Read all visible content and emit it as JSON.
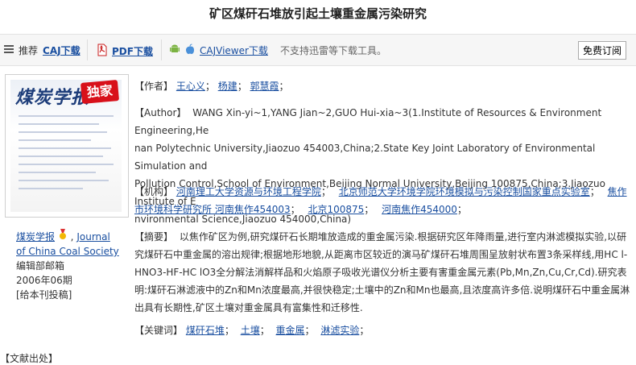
{
  "title": "矿区煤矸石堆放引起土壤重金属污染研究",
  "toolbar": {
    "recommend": "推荐",
    "caj": "CAJ下载",
    "pdf": "PDF下载",
    "cajviewer": "CAJViewer下载",
    "notice": "不支持迅雷等下载工具。",
    "subscribe": "免费订阅"
  },
  "cover": {
    "title_text": "煤炭学报",
    "badge": "独家"
  },
  "journal": {
    "name_cn": "煤炭学报",
    "comma": ",",
    "name_en": "Journal of China Coal Society",
    "editor": "编辑部邮箱",
    "issue": "2006年06期",
    "submit": "[给本刊投稿]"
  },
  "meta": {
    "author_label": "【作者】",
    "authors": [
      "王心义",
      "杨建",
      "郭慧霞"
    ],
    "author_en_label": "【Author】",
    "author_en_lines": [
      "WANG Xin-yi~1,YANG Jian~2,GUO Hui-xia~3(1.Institute of Resources & Environment Engineering,He",
      "nan Polytechnic University,Jiaozuo 454003,China;2.State Key Joint Laboratory of Environmental Simulation and",
      "Pollution Control,School of Environment,Beijing Normal University,Beijing 100875,China;3.Jiaozuo Institute of E",
      "nvironmental Science,Jiaozuo 454000,China)"
    ],
    "org_label": "【机构】",
    "orgs_line1": [
      "河南理工大学资源与环境工程学院",
      "北京师范大学环境学院环境模拟与污染控制国家重点实验室",
      "焦作"
    ],
    "orgs_line2": [
      "市环境科学研究所 河南焦作454003",
      "北京100875",
      "河南焦作454000"
    ],
    "abstract_label": "【摘要】",
    "abstract_lines": [
      "以焦作矿区为例,研究煤矸石长期堆放造成的重金属污染.根据研究区年降雨量,进行室内淋滤模拟实验,以研",
      "究煤矸石中重金属的溶出规律;根据地形地貌,从距离市区较近的演马矿煤矸石堆周围呈放射状布置3条采样线,用HC l-",
      "HNO3-HF-HC lO3全分解法消解样品和火焰原子吸收光谱仪分析主要有害重金属元素(Pb,Mn,Zn,Cu,Cr,Cd).研究表",
      "明:煤矸石淋滤液中的Zn和Mn浓度最高,并很快稳定;土壤中的Zn和Mn也最高,且浓度高许多倍.说明煤矸石中重金属淋",
      "出具有长期性,矿区土壤对重金属具有富集性和迁移性."
    ],
    "keyword_label": "【关键词】",
    "keywords": [
      "煤矸石堆",
      "土壤",
      "重金属",
      "淋滤实验"
    ]
  },
  "footer": "【文献出处】"
}
